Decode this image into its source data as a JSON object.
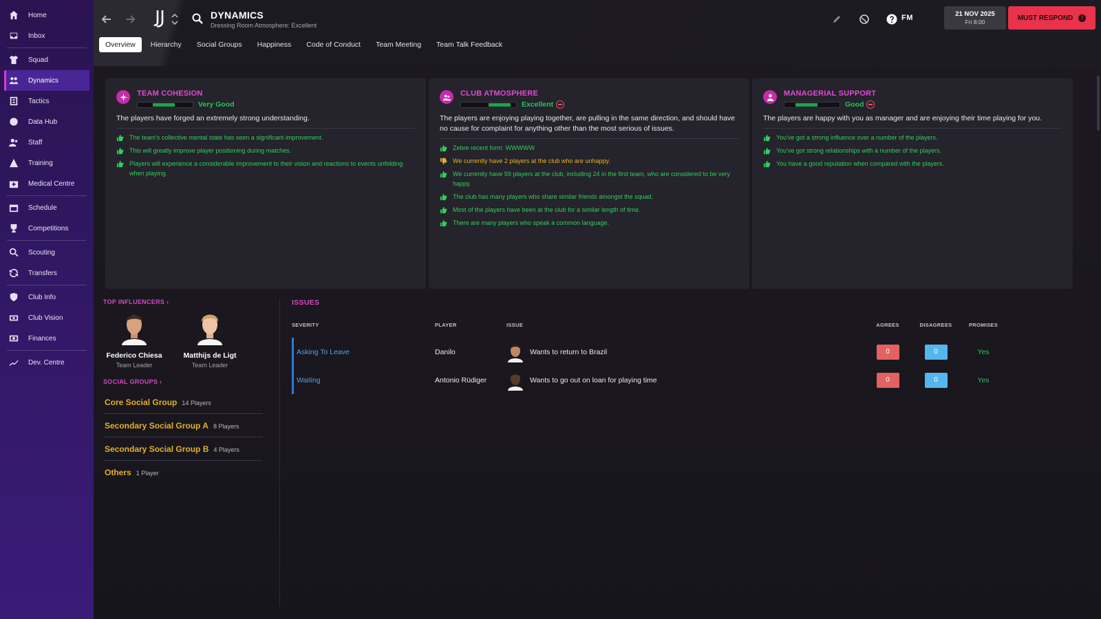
{
  "sidebar": {
    "items": [
      {
        "label": "Home",
        "icon": "home-icon"
      },
      {
        "label": "Inbox",
        "icon": "inbox-icon"
      },
      {
        "label": "Squad",
        "icon": "shirt-icon"
      },
      {
        "label": "Dynamics",
        "icon": "dynamics-icon",
        "active": true
      },
      {
        "label": "Tactics",
        "icon": "tactics-icon"
      },
      {
        "label": "Data Hub",
        "icon": "data-hub-icon"
      },
      {
        "label": "Staff",
        "icon": "staff-icon"
      },
      {
        "label": "Training",
        "icon": "training-icon"
      },
      {
        "label": "Medical Centre",
        "icon": "medical-icon"
      },
      {
        "label": "Schedule",
        "icon": "calendar-icon"
      },
      {
        "label": "Competitions",
        "icon": "trophy-icon"
      },
      {
        "label": "Scouting",
        "icon": "scouting-icon"
      },
      {
        "label": "Transfers",
        "icon": "transfers-icon"
      },
      {
        "label": "Club Info",
        "icon": "shield-icon"
      },
      {
        "label": "Club Vision",
        "icon": "vision-icon"
      },
      {
        "label": "Finances",
        "icon": "finances-icon"
      },
      {
        "label": "Dev. Centre",
        "icon": "dev-centre-icon"
      }
    ]
  },
  "header": {
    "title": "DYNAMICS",
    "subtitle": "Dressing Room Atmosphere: Excellent",
    "date": "21 NOV 2025",
    "time": "Fri 8:00",
    "must_respond": "MUST RESPOND",
    "fm_label": "FM"
  },
  "tabs": [
    {
      "label": "Overview",
      "active": true
    },
    {
      "label": "Hierarchy"
    },
    {
      "label": "Social Groups"
    },
    {
      "label": "Happiness"
    },
    {
      "label": "Code of Conduct"
    },
    {
      "label": "Team Meeting"
    },
    {
      "label": "Team Talk Feedback"
    }
  ],
  "cards": [
    {
      "title": "TEAM COHESION",
      "rating": "Very Good",
      "level": 0.68,
      "description": "The players have forged an extremely strong understanding.",
      "facts": [
        {
          "text": "The team's collective mental state has seen a significant improvement.",
          "tone": "good"
        },
        {
          "text": "This will greatly improve player positioning during matches.",
          "tone": "good"
        },
        {
          "text": "Players will experience a considerable improvement to their vision and reactions to events unfolding when playing.",
          "tone": "good"
        }
      ]
    },
    {
      "title": "CLUB ATMOSPHERE",
      "rating": "Excellent",
      "level": 0.9,
      "description": "The players are enjoying playing together, are pulling in the same direction, and should have no cause for complaint for anything other than the most serious of issues.",
      "facts": [
        {
          "text": "Zebre recent form: WWWWW",
          "tone": "good"
        },
        {
          "text": "We currently have 2 players at the club who are unhappy.",
          "tone": "bad"
        },
        {
          "text": "We currently have 59 players at the club, including 24 in the first team, who are considered to be very happy.",
          "tone": "good"
        },
        {
          "text": "The club has many players who share similar friends amongst the squad.",
          "tone": "good"
        },
        {
          "text": "Most of the players have been at the club for a similar length of time.",
          "tone": "good"
        },
        {
          "text": "There are many players who speak a common language.",
          "tone": "good"
        }
      ]
    },
    {
      "title": "MANAGERIAL SUPPORT",
      "rating": "Good",
      "level": 0.6,
      "description": "The players are happy with you as manager and are enjoying their time playing for you.",
      "facts": [
        {
          "text": "You've got a strong influence over a number of the players.",
          "tone": "good"
        },
        {
          "text": "You've got strong relationships with a number of the players.",
          "tone": "good"
        },
        {
          "text": "You have a good reputation when compared with the players.",
          "tone": "good"
        }
      ]
    }
  ],
  "influencers": {
    "heading": "TOP INFLUENCERS",
    "players": [
      {
        "name": "Federico Chiesa",
        "role": "Team Leader"
      },
      {
        "name": "Matthijs de Ligt",
        "role": "Team Leader"
      }
    ]
  },
  "social_groups": {
    "heading": "SOCIAL GROUPS",
    "items": [
      {
        "name": "Core Social Group",
        "count": "14 Players"
      },
      {
        "name": "Secondary Social Group A",
        "count": "8 Players"
      },
      {
        "name": "Secondary Social Group B",
        "count": "4 Players"
      },
      {
        "name": "Others",
        "count": "1 Player"
      }
    ]
  },
  "issues": {
    "title": "ISSUES",
    "columns": [
      "SEVERITY",
      "PLAYER",
      "ISSUE",
      "AGREES",
      "DISAGREES",
      "PROMISES"
    ],
    "rows": [
      {
        "severity": "Asking To Leave",
        "player": "Danilo",
        "issue": "Wants to return to Brazil",
        "agrees": "0",
        "disagrees": "0",
        "promises": "Yes"
      },
      {
        "severity": "Waiting",
        "player": "Antonio Rüdiger",
        "issue": "Wants to go out on loan for playing time",
        "agrees": "0",
        "disagrees": "0",
        "promises": "Yes"
      }
    ]
  },
  "colors": {
    "accent": "#d846c7",
    "good": "#2ed15c",
    "warning": "#e6b620",
    "must_respond": "#e8334a",
    "sidebar": "#2f1760"
  }
}
